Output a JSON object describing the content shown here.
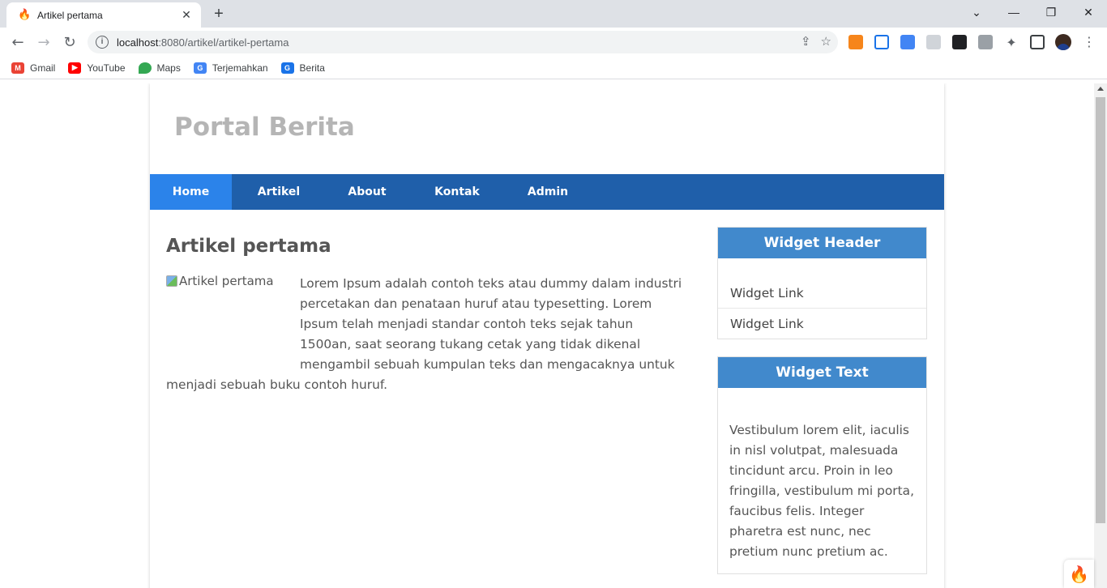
{
  "browser": {
    "tab_title": "Artikel pertama",
    "tab_favicon": "codeigniter-flame-icon",
    "url_host": "localhost",
    "url_port": ":8080",
    "url_path": "/artikel/artikel-pertama",
    "bookmarks": [
      {
        "label": "Gmail",
        "icon": "gmail-icon",
        "color": "#ea4335"
      },
      {
        "label": "YouTube",
        "icon": "youtube-icon",
        "color": "#ff0000"
      },
      {
        "label": "Maps",
        "icon": "maps-pin-icon",
        "color": "#34a853"
      },
      {
        "label": "Terjemahkan",
        "icon": "translate-icon",
        "color": "#4285f4"
      },
      {
        "label": "Berita",
        "icon": "news-icon",
        "color": "#1a73e8"
      }
    ]
  },
  "site": {
    "title": "Portal Berita",
    "nav": [
      {
        "label": "Home",
        "active": true
      },
      {
        "label": "Artikel",
        "active": false
      },
      {
        "label": "About",
        "active": false
      },
      {
        "label": "Kontak",
        "active": false
      },
      {
        "label": "Admin",
        "active": false
      }
    ]
  },
  "article": {
    "title": "Artikel pertama",
    "image_alt": "Artikel pertama",
    "body": "Lorem Ipsum adalah contoh teks atau dummy dalam industri percetakan dan penataan huruf atau typesetting. Lorem Ipsum telah menjadi standar contoh teks sejak tahun 1500an, saat seorang tukang cetak yang tidak dikenal mengambil sebuah kumpulan teks dan mengacaknya untuk menjadi sebuah buku contoh huruf."
  },
  "sidebar": {
    "widget_links": {
      "header": "Widget Header",
      "links": [
        "Widget Link",
        "Widget Link"
      ]
    },
    "widget_text": {
      "header": "Widget Text",
      "text": "Vestibulum lorem elit, iaculis in nisl volutpat, malesuada tincidunt arcu. Proin in leo fringilla, vestibulum mi porta, faucibus felis. Integer pharetra est nunc, nec pretium nunc pretium ac."
    }
  },
  "colors": {
    "nav_bg": "#1f5faa",
    "nav_active": "#2b83ea",
    "widget_header": "#4189cc",
    "site_title": "#b5b5b5"
  }
}
